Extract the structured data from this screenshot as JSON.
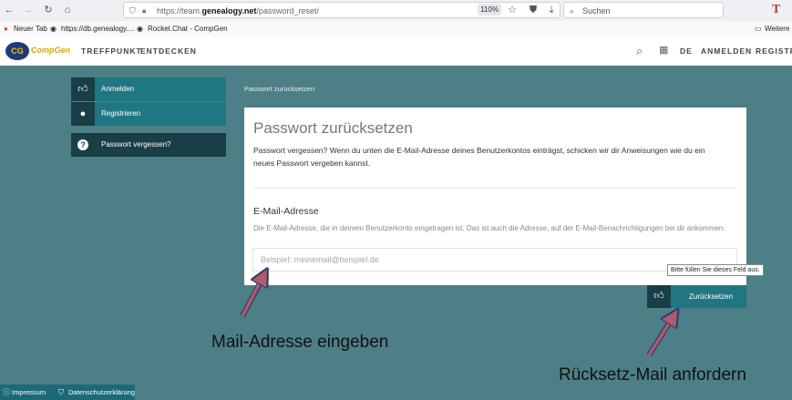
{
  "browser": {
    "url_prefix": "https://team.",
    "url_domain": "genealogy.net",
    "url_path": "/password_reset/",
    "zoom": "110%",
    "search_placeholder": "Suchen",
    "icons": [
      "back-icon",
      "forward-icon",
      "reload-icon",
      "home-icon",
      "shield-icon",
      "lock-icon",
      "star-icon",
      "pocket-icon",
      "download-icon",
      "search-icon"
    ],
    "bookmarks": [
      "Neuer Tab",
      "https://db.genealogy....",
      "Rocket.Chat - CompGen"
    ],
    "other_bookmarks": "Weitere L"
  },
  "site": {
    "logo_text": "CompGen",
    "nav": [
      "TREFFPUNKT",
      "ENTDECKEN"
    ],
    "lang": "DE",
    "login": "ANMELDEN",
    "register": "REGISTRI"
  },
  "sidebar": {
    "items": [
      {
        "label": "Anmelden",
        "icon": "thumb-icon"
      },
      {
        "label": "Registrieren",
        "icon": "user-icon"
      },
      {
        "label": "Passwort vergessen?",
        "icon": "question-icon"
      }
    ]
  },
  "main": {
    "breadcrumb": "Passwort zurücksetzen",
    "title": "Passwort zurücksetzen",
    "intro": "Passwort vergessen? Wenn du unten die E-Mail-Adresse deines Benutzerkontos einträgst, schicken wir dir Anweisungen wie du ein neues Passwort vergeben kannst.",
    "field_label": "E-Mail-Adresse",
    "field_help": "Die E-Mail-Adresse, die in deinem Benutzerkonto eingetragen ist. Das ist auch die Adresse, auf der E-Mail-Benachrichtigungen bei dir ankommen.",
    "email_value": "",
    "email_placeholder": "Beispiel: meinemail@beispiel.de",
    "tooltip": "Bitte füllen Sie dieses Feld aus.",
    "submit_label": "Zurücksetzen"
  },
  "annotations": {
    "left": "Mail-Adresse eingeben",
    "right": "Rücksetz-Mail anfordern"
  },
  "footer": {
    "impressum": "Impressum",
    "privacy": "Datenschutzerklärung"
  },
  "colors": {
    "background": "#4d7f86",
    "accent": "#207682",
    "dark_accent": "#1a3e45",
    "arrow": "#b05a6a",
    "logo": "#e0a800"
  }
}
